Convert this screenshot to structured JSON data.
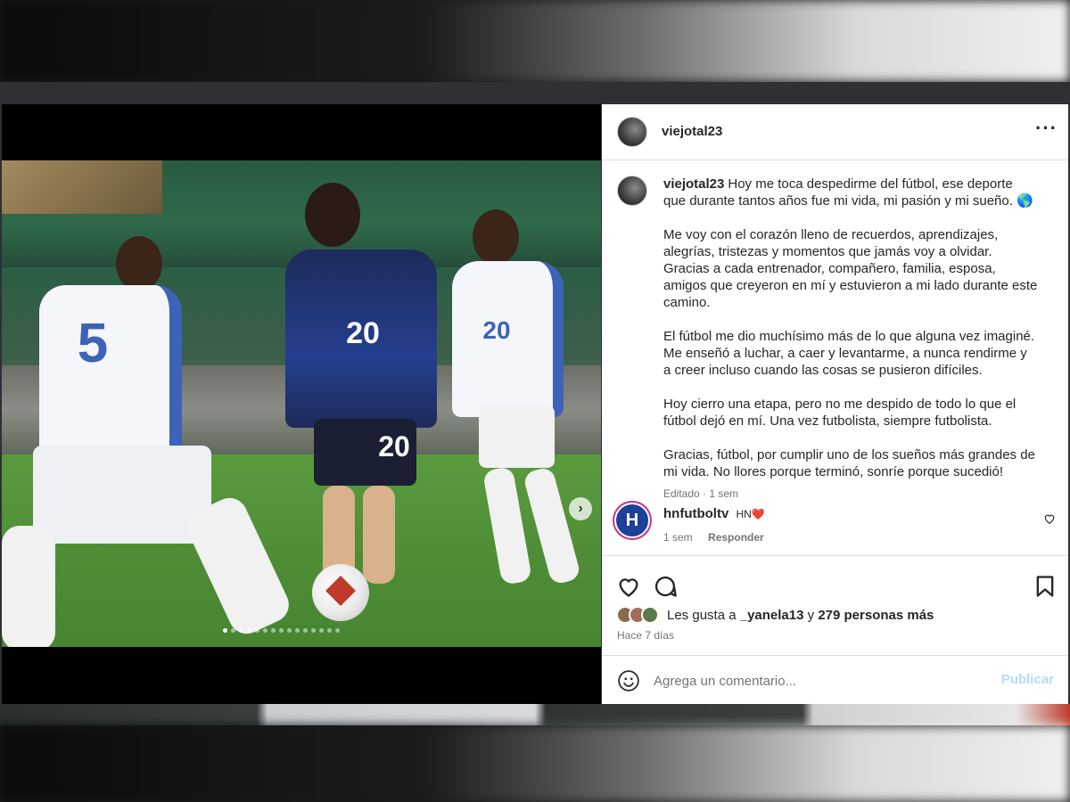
{
  "post": {
    "author": "viejotal23",
    "caption_username": "viejotal23",
    "caption_paragraphs": [
      "Hoy me toca despedirme del fútbol, ese deporte que durante tantos años fue mi vida, mi pasión y mi sueño. 🌎",
      "Me voy con el corazón lleno de recuerdos, aprendizajes, alegrías, tristezas y momentos que jamás voy a olvidar. Gracias a cada entrenador, compañero, familia, esposa, amigos que creyeron en mí y estuvieron a mi lado durante este camino.",
      "El fútbol me dio muchísimo más de lo que alguna vez imaginé. Me enseñó a luchar, a caer y levantarme, a nunca rendirme y a creer incluso cuando las cosas se pusieron difíciles.",
      "Hoy cierro una etapa, pero no me despido de todo lo que el fútbol dejó en mí. Una vez futbolista, siempre futbolista.",
      "Gracias, fútbol, por cumplir uno de los sueños más grandes de mi vida. No llores porque terminó, sonríe porque sucedió!"
    ],
    "caption_meta": "Editado · 1 sem",
    "more_icon": "more-icon"
  },
  "media": {
    "player_numbers": [
      "5",
      "20",
      "20",
      "20"
    ],
    "carousel_count": 15,
    "carousel_active": 0
  },
  "comment": {
    "username": "hnfutboltv",
    "text": "HN❤️",
    "avatar_letter": "H",
    "time": "1 sem",
    "reply_label": "Responder"
  },
  "likes": {
    "prefix": "Les gusta a ",
    "user": "_yanela13",
    "middle": " y ",
    "count": "279 personas más",
    "date": "Hace 7 días"
  },
  "add_comment": {
    "placeholder": "Agrega un comentario...",
    "publish_label": "Publicar"
  },
  "colors": {
    "accent": "#b3dbff",
    "heart": "#ed4956",
    "text": "#262626",
    "muted": "#737373"
  }
}
